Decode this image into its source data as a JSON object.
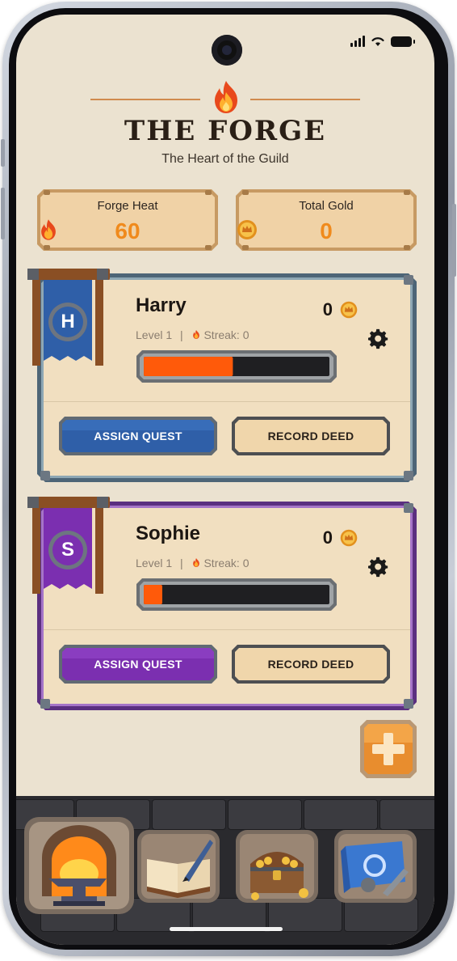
{
  "app": {
    "title": "THE FORGE",
    "subtitle": "The Heart of the Guild"
  },
  "stats": {
    "forge_heat_label": "Forge Heat",
    "forge_heat_value": "60",
    "total_gold_label": "Total Gold",
    "total_gold_value": "0"
  },
  "members": [
    {
      "initial": "H",
      "name": "Harry",
      "level": "Level 1",
      "separator": "|",
      "streak": "Streak: 0",
      "gold": "0",
      "xp_fraction": 0.48,
      "theme_color": "#2f5fa8",
      "assign_label": "ASSIGN QUEST",
      "record_label": "RECORD DEED"
    },
    {
      "initial": "S",
      "name": "Sophie",
      "level": "Level 1",
      "separator": "|",
      "streak": "Streak: 0",
      "gold": "0",
      "xp_fraction": 0.1,
      "theme_color": "#7b2fb0",
      "assign_label": "ASSIGN QUEST",
      "record_label": "RECORD DEED"
    }
  ],
  "nav": {
    "items": [
      "forge-anvil-icon",
      "journal-quill-icon",
      "treasure-chest-icon",
      "blueprint-tools-icon"
    ],
    "selected": "forge-anvil-icon"
  },
  "colors": {
    "background": "#ebe2d0",
    "accent_orange": "#f08a1c",
    "xp_fill": "#ff5a0a"
  }
}
